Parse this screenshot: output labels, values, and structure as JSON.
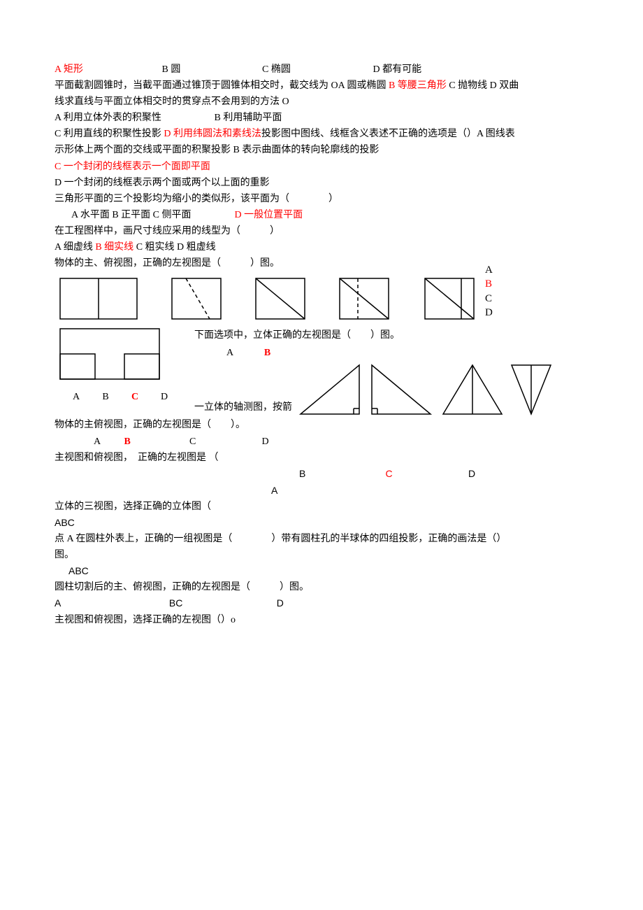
{
  "q1": {
    "a": "A 矩形",
    "b": "B 圆",
    "c": "C 椭圆",
    "d": "D 都有可能"
  },
  "line2": {
    "t1": "平面截割圆锥时，当截平面通过锥顶于圆锥体相交时，截交线为 OA 圆或椭圆 ",
    "tB": "B 等腰三角形",
    "t2": " C 抛物线 D 双曲"
  },
  "line3": "线求直线与平面立体相交时的贯穿点不会用到的方法 O",
  "line4": {
    "a": "A 利用立体外表的积聚性",
    "b": "B 利用辅助平面"
  },
  "line5": {
    "t1": "C 利用直线的积聚性投影 ",
    "tD": "D 利用纬圆法和素线法",
    "t2": "投影图中图线、线框含义表述不正确的选项是（）A 图线表"
  },
  "line6": "示形体上两个面的交线或平面的积聚投影 B 表示曲面体的转向轮廓线的投影",
  "line7": "C 一个封闭的线框表示一个面即平面",
  "line8": "D 一个封闭的线框表示两个面或两个以上面的重影",
  "line9": "三角形平面的三个投影均为缩小的类似形，该平面为（　　　　）",
  "line10": {
    "t1": "A 水平面 B 正平面 C 侧平面",
    "tD": "D 一般位置平面"
  },
  "line11": "在工程图样中，画尺寸线应采用的线型为（　　　）",
  "line12": {
    "t1": "A 细虚线 ",
    "tB": "B 细实线",
    "t2": " C 粗实线 D 粗虚线"
  },
  "line13": "物体的主、俯视图，正确的左视图是（　　　）图。",
  "answerCol": {
    "A": "A",
    "B": "B",
    "C": "C",
    "D": "D"
  },
  "mid1": "下面选项中，立体正确的左视图是（　　）图。",
  "mid2a": "A",
  "mid2b": "B",
  "mid3": "一立体的轴测图，按箭",
  "lblRow": {
    "A": "A",
    "B": "B",
    "C": "C",
    "D": "D"
  },
  "line14": "物体的主俯视图，正确的左视图是（　　）。",
  "line15": {
    "A": "A",
    "B": "B",
    "C": "C",
    "D": "D"
  },
  "line16": "主视图和俯视图，　正确的左视图是 （",
  "line17": {
    "B": "B",
    "C": "C",
    "D": "D"
  },
  "line18": "A",
  "line19": "立体的三视图，选择正确的立体图（",
  "line20": "ABC",
  "line21": "点 A 在圆柱外表上，正确的一组视图是（　　　　）带有圆柱孔的半球体的四组投影，正确的画法是（）",
  "line22": "图。",
  "line23": "ABC",
  "line24": "圆柱切割后的主、俯视图，正确的左视图是（　　　）图。",
  "line25": {
    "a": "A",
    "bc": "BC",
    "d": "D"
  },
  "line26": "主视图和俯视图，选择正确的左视图（）o"
}
